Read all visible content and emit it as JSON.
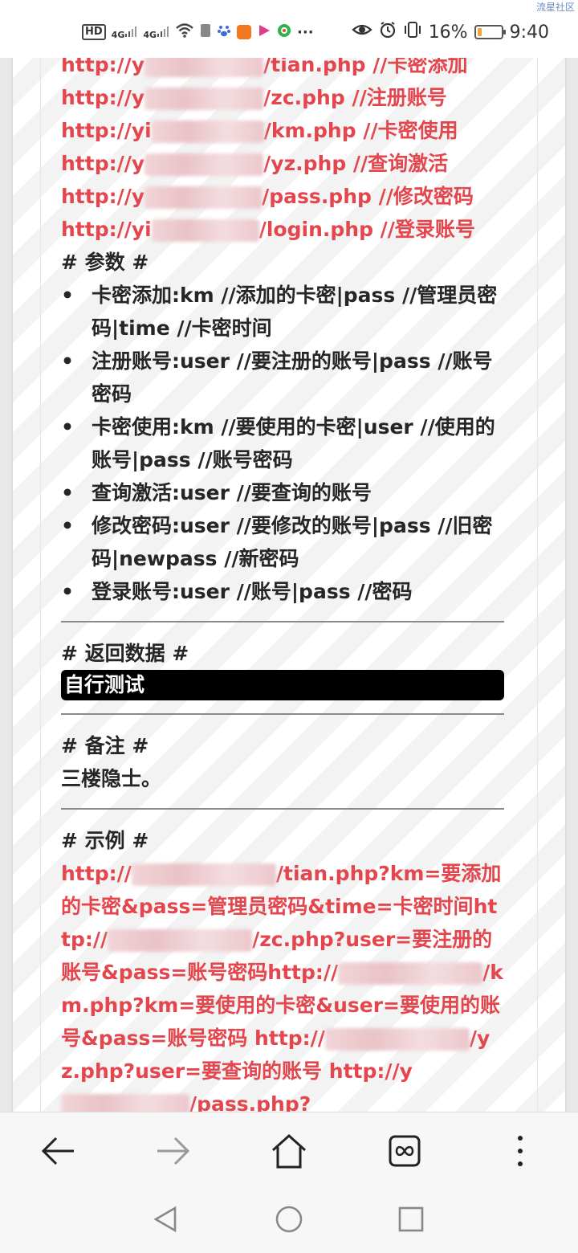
{
  "status_bar": {
    "watermark": "流星社区",
    "hd_label": "HD",
    "sig1": "4G",
    "sig2": "4G",
    "battery_percent": "16%",
    "time": "9:40",
    "icons": [
      "hd-icon",
      "signal-icon",
      "signal-icon",
      "wifi-icon",
      "sim-icon",
      "paw-icon",
      "uc-browser-icon",
      "video-icon",
      "circle-app-icon",
      "more-dots-icon",
      "eye-icon",
      "alarm-icon",
      "vibrate-icon",
      "battery-icon"
    ]
  },
  "content": {
    "urls": [
      {
        "prefix": "http://y",
        "suffix": "/tian.php //卡密添加"
      },
      {
        "prefix": "http://y",
        "suffix": "/zc.php //注册账号"
      },
      {
        "prefix": "http://yi",
        "suffix": "/km.php //卡密使用"
      },
      {
        "prefix": "http://y",
        "suffix": "/yz.php //查询激活"
      },
      {
        "prefix": "http://y",
        "suffix": "/pass.php //修改密码"
      },
      {
        "prefix": "http://yi",
        "suffix": "/login.php //登录账号"
      }
    ],
    "params_heading": "# 参数 #",
    "params": [
      "卡密添加:km //添加的卡密|pass //管理员密码|time //卡密时间",
      "注册账号:user //要注册的账号|pass //账号密码",
      "卡密使用:km //要使用的卡密|user //使用的账号|pass //账号密码",
      "查询激活:user //要查询的账号",
      "修改密码:user //要修改的账号|pass //旧密码|newpass //新密码",
      "登录账号:user //账号|pass //密码"
    ],
    "return_heading": "# 返回数据 #",
    "return_value": "自行测试",
    "note_heading": "# 备注 #",
    "note_value": "三楼隐士。",
    "example_heading": "# 示例 #",
    "examples": [
      {
        "prefix": "http://",
        "suffix": "/tian.php?km=要添加的卡密&pass=管理员密码&time=卡密时间"
      },
      {
        "prefix": "http://",
        "suffix": "/zc.php?user=要注册的账号&pass=账号密码"
      },
      {
        "prefix": "http://",
        "suffix": "/km.php?km=要使用的卡密&user=要使用的账号&pass=账号密码"
      },
      {
        "prefix": "http://",
        "suffix": "/yz.php?user=要查询的账号"
      },
      {
        "prefix": "http://y",
        "suffix": "/pass.php?"
      }
    ]
  },
  "colors": {
    "link_red": "#e4464d",
    "text": "#262626",
    "battery_low": "#f2a531"
  }
}
